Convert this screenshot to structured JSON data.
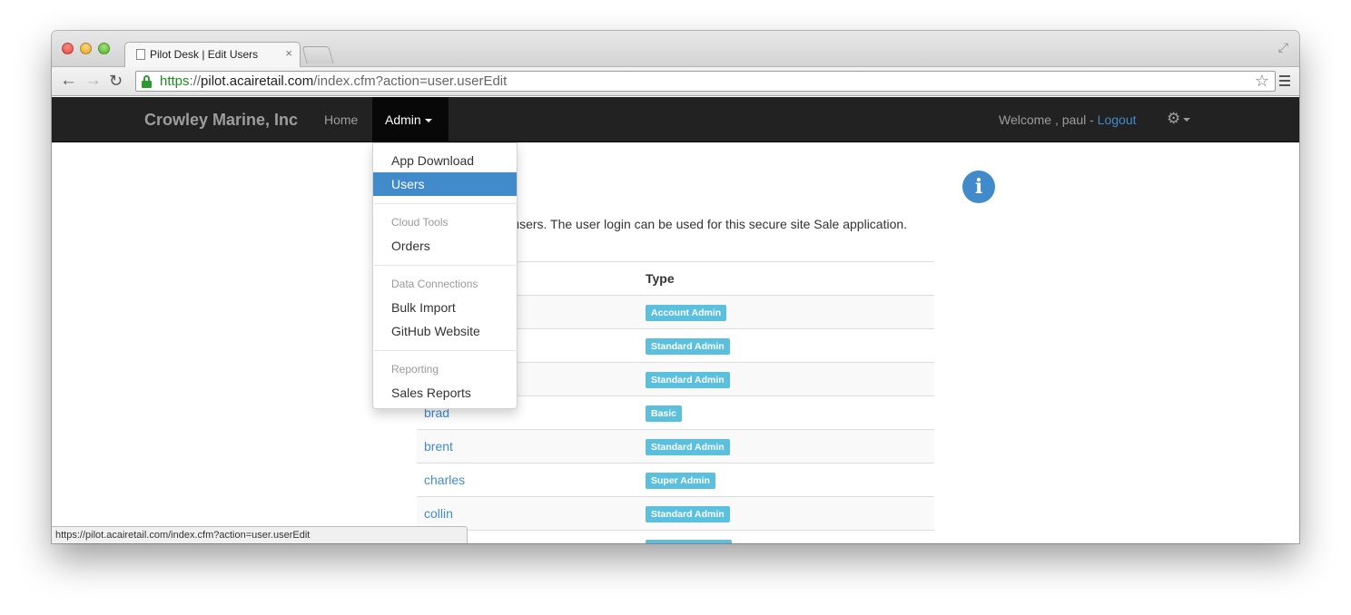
{
  "browser": {
    "tab_title": "Pilot Desk | Edit Users",
    "tab_close": "×",
    "url_scheme": "https",
    "url_separator": "://",
    "url_host": "pilot.acairetail.com",
    "url_path": "/index.cfm?action=user.userEdit",
    "status_url": "https://pilot.acairetail.com/index.cfm?action=user.userEdit"
  },
  "navbar": {
    "brand": "Crowley Marine, Inc",
    "home_label": "Home",
    "admin_label": "Admin",
    "welcome_text": "Welcome , paul - ",
    "logout_label": "Logout"
  },
  "dropdown": {
    "item_app_download": "App Download",
    "item_users": "Users",
    "header_cloud_tools": "Cloud Tools",
    "item_orders": "Orders",
    "header_data_connections": "Data Connections",
    "item_bulk_import": "Bulk Import",
    "item_github_website": "GitHub Website",
    "header_reporting": "Reporting",
    "item_sales_reports": "Sales Reports"
  },
  "content": {
    "description": "nd edit existing users. The user login can be used for this secure site Sale application.",
    "table": {
      "header_type": "Type",
      "rows": [
        {
          "name": "",
          "type": "Account Admin"
        },
        {
          "name": "",
          "type": "Standard Admin"
        },
        {
          "name": "",
          "type": "Standard Admin"
        },
        {
          "name": "brad",
          "type": "Basic"
        },
        {
          "name": "brent",
          "type": "Standard Admin"
        },
        {
          "name": "charles",
          "type": "Super Admin"
        },
        {
          "name": "collin",
          "type": "Standard Admin"
        },
        {
          "name": "",
          "type": ""
        }
      ]
    }
  },
  "icons": {
    "info": "i",
    "gear": "⚙",
    "back": "←",
    "forward": "→",
    "reload": "↻",
    "star": "☆",
    "fullscreen": "⤢"
  },
  "colors": {
    "navbar_bg": "#222222",
    "link": "#428bca",
    "label_info": "#5bc0de",
    "dropdown_active": "#428bca"
  }
}
